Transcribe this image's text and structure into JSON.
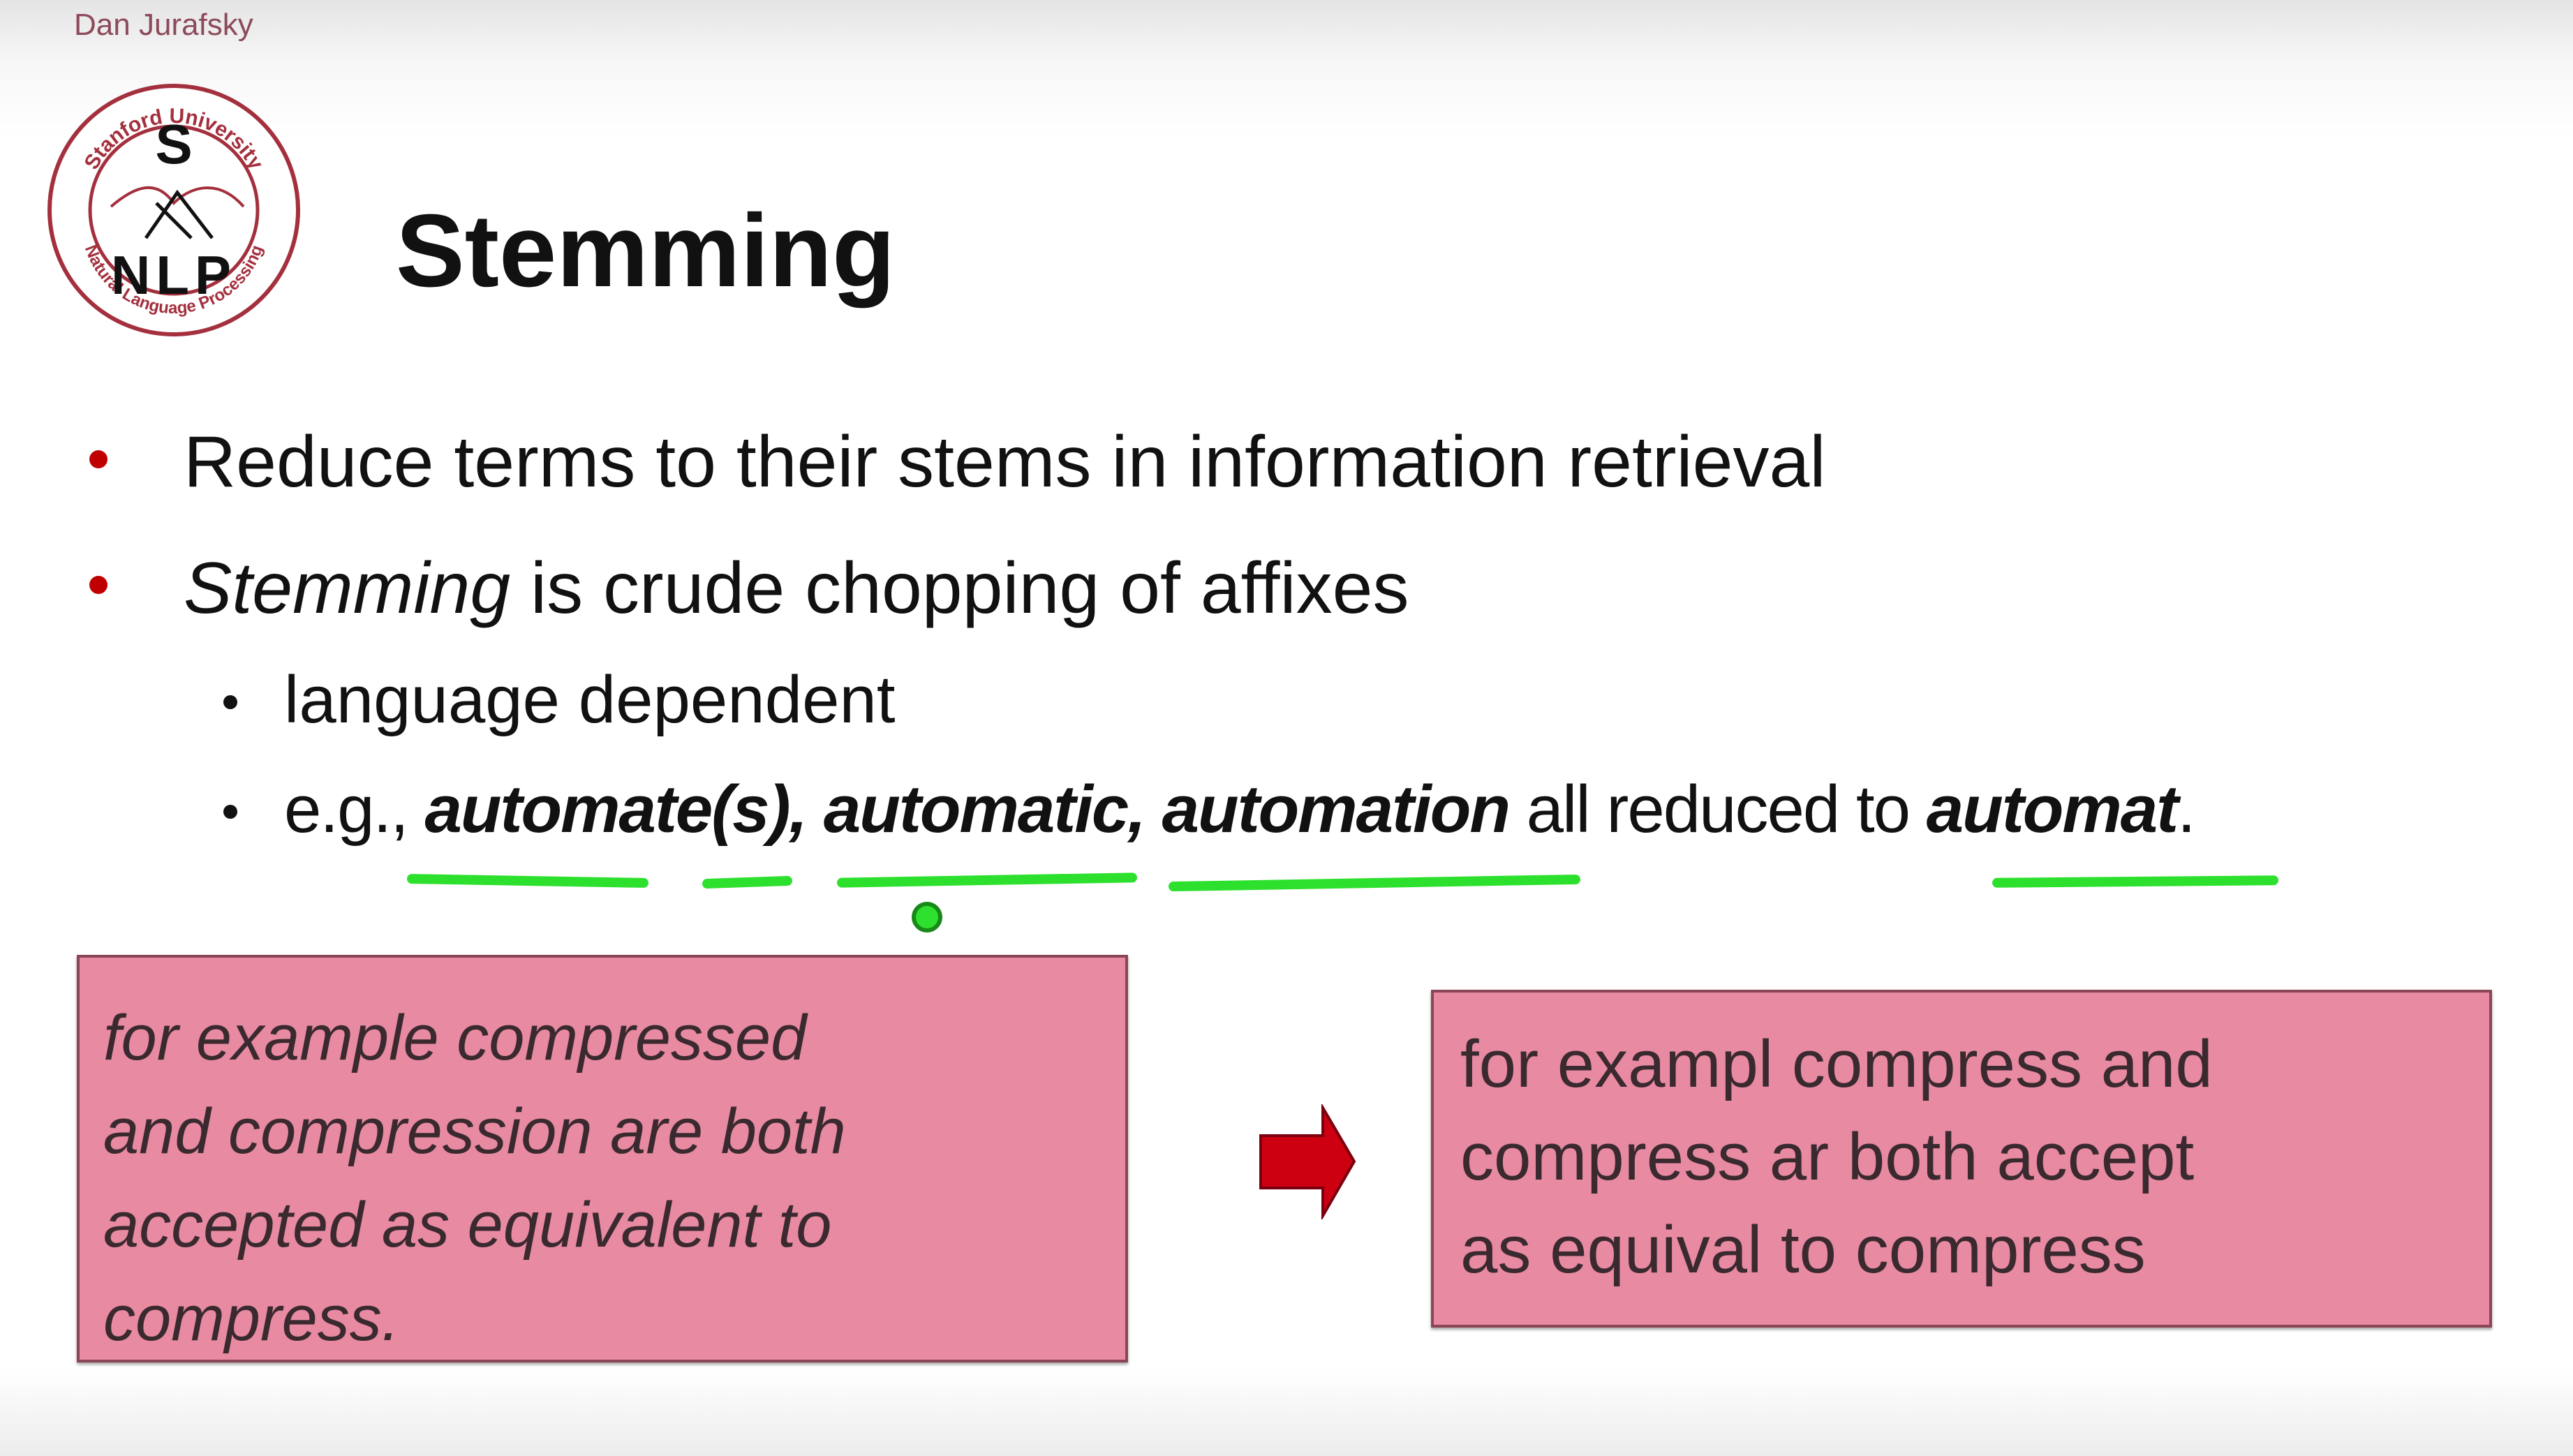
{
  "header": {
    "author": "Dan Jurafsky"
  },
  "logo": {
    "top_text": "Stanford University",
    "bottom_text": "Natural Language Processing",
    "letter_top": "S",
    "letters_bottom": "NLP"
  },
  "slide": {
    "title": "Stemming",
    "bullets": [
      {
        "text": "Reduce terms to their stems in information retrieval"
      },
      {
        "italic": "Stemming",
        "rest": " is crude chopping of affixes"
      }
    ],
    "sub_bullets": [
      {
        "text": "language dependent"
      },
      {
        "prefix": "e.g., ",
        "bold_italic": "automate(s), automatic, automation",
        "middle": " all reduced to ",
        "bold_italic_end": "automat",
        "suffix": "."
      }
    ],
    "original_box": [
      "for example compressed",
      "and compression are both",
      "accepted as equivalent to",
      "compress."
    ],
    "stemmed_box": [
      "for exampl compress and",
      "compress ar both accept",
      "as equival to compress"
    ]
  },
  "colors": {
    "bullet": "#c00000",
    "box_fill": "#e88aa1",
    "box_border": "#8a4656",
    "annotation": "#2ee02e",
    "arrow": "#cc0010"
  },
  "icons": {
    "arrow": "right-arrow-icon"
  }
}
